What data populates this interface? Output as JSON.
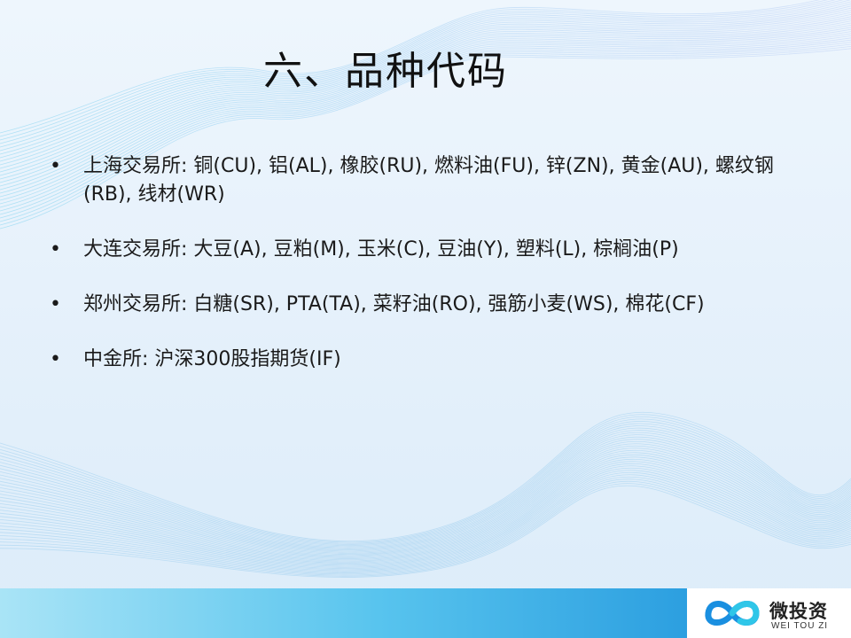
{
  "slide": {
    "title": "六、品种代码",
    "bullets": [
      {
        "text": "上海交易所:  铜(CU), 铝(AL), 橡胶(RU), 燃料油(FU), 锌(ZN), 黄金(AU), 螺纹钢(RB), 线材(WR)"
      },
      {
        "text": "大连交易所:  大豆(A), 豆粕(M), 玉米(C), 豆油(Y), 塑料(L), 棕榈油(P)"
      },
      {
        "text": "郑州交易所:  白糖(SR), PTA(TA), 菜籽油(RO), 强筋小麦(WS), 棉花(CF)"
      },
      {
        "text": "中金所: 沪深300股指期货(IF)"
      }
    ],
    "bullet_symbol": "•"
  },
  "logo": {
    "name_cn": "微投资",
    "name_en": "WEI TOU ZI",
    "icon": "infinity-loop-icon"
  },
  "colors": {
    "footer_start": "#a9e4f6",
    "footer_end": "#2c9fe0",
    "logo_blue": "#1a8fe0",
    "logo_cyan": "#2fc6e8"
  }
}
